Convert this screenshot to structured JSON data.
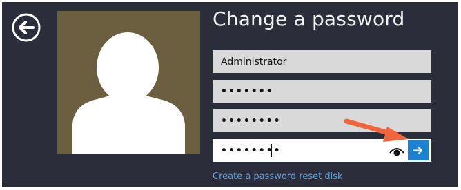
{
  "window": {
    "title": "Change a password"
  },
  "form": {
    "username": "Administrator",
    "old_password": "•••••••",
    "new_password": "••••••••",
    "confirm_password": "••••••••"
  },
  "link": {
    "reset_disk": "Create a password reset disk"
  },
  "icons": {
    "back": "back-arrow-icon",
    "avatar": "user-silhouette-icon",
    "reveal": "eye-icon",
    "submit": "right-arrow-icon",
    "annotation": "pointer-arrow"
  },
  "colors": {
    "background": "#2c2d3a",
    "avatar_bg": "#6b5f3f",
    "field_bg": "#d9d9d9",
    "submit_bg": "#1e82d2",
    "link": "#5aa7e8",
    "annotation_arrow": "#f0663a"
  }
}
